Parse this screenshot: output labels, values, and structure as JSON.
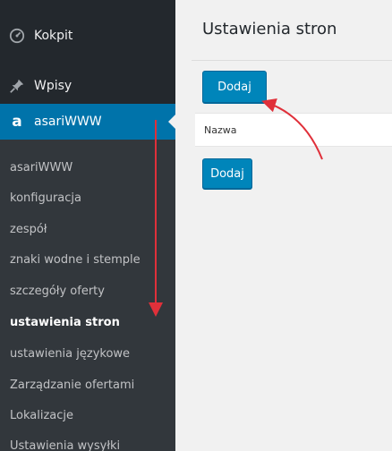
{
  "sidebar": {
    "kokpit_label": "Kokpit",
    "wpisy_label": "Wpisy",
    "asari_label": "asariWWW",
    "asari_icon_glyph": "a",
    "submenu": [
      "asariWWW",
      "konfiguracja",
      "zespół",
      "znaki wodne i stemple",
      "szczegóły oferty",
      "ustawienia stron",
      "ustawienia językowe",
      "Zarządzanie ofertami",
      "Lokalizacje",
      "Ustawienia wysyłki"
    ],
    "current_item": "ustawienia stron"
  },
  "main": {
    "title": "Ustawienia stron",
    "add_button_label": "Dodaj",
    "add_button_bottom_label": "Dodaj",
    "table_column": "Nazwa"
  },
  "colors": {
    "sidebar_bg": "#23282d",
    "submenu_bg": "#32373c",
    "accent": "#0073aa",
    "button": "#0085ba",
    "annotation_arrow": "#e0303a"
  },
  "icons": {
    "kokpit": "dashboard-icon",
    "wpisy": "pushpin-icon",
    "asari": "asari-icon"
  }
}
